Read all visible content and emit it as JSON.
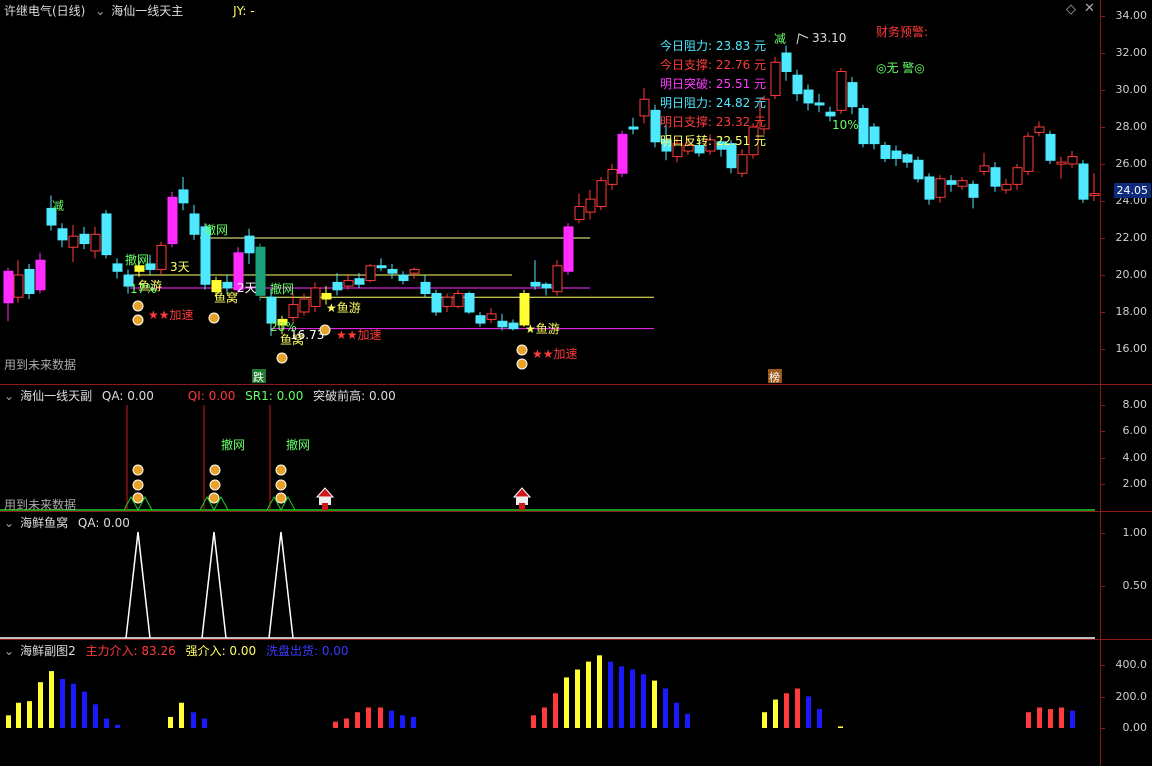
{
  "main": {
    "title": "许继电气(日线)",
    "indicator": "海仙一线天主",
    "jy": "JY: -",
    "future_note": "用到未来数据",
    "levels": [
      {
        "label": "今日阻力:",
        "value": "23.83 元",
        "color": "#4ee8ff"
      },
      {
        "label": "今日支撑:",
        "value": "22.76 元",
        "color": "#ff3b3b"
      },
      {
        "label": "明日突破:",
        "value": "25.51 元",
        "color": "#ff3bff"
      },
      {
        "label": "明日阻力:",
        "value": "24.82 元",
        "color": "#4ee8ff"
      },
      {
        "label": "明日支撑:",
        "value": "23.32 元",
        "color": "#ff3b3b"
      },
      {
        "label": "明日反转:",
        "value": "22.51 元",
        "color": "#ffff66"
      }
    ],
    "finance_warning": "财务预警:",
    "no_warning": "◎无 警◎",
    "high_label": "33.10",
    "jian_top": "减",
    "jian_left": "减",
    "pct_label": "10%",
    "current_price": "24.05",
    "y_ticks": [
      "34.00",
      "32.00",
      "30.00",
      "28.00",
      "26.00",
      "24.00",
      "22.00",
      "20.00",
      "18.00",
      "16.00"
    ],
    "annotations": [
      {
        "t": "撤网",
        "c": "#66ff66"
      },
      {
        "t": "撤网",
        "c": "#66ff66"
      },
      {
        "t": "撤网",
        "c": "#66ff66"
      },
      {
        "t": "鱼游",
        "c": "#ffff66"
      },
      {
        "t": "鱼窝",
        "c": "#ffff66"
      },
      {
        "t": "3天",
        "c": "#ffff66"
      },
      {
        "t": "2天",
        "c": "#ffffff"
      },
      {
        "t": "★鱼游",
        "c": "#ffff66"
      },
      {
        "t": "★鱼游",
        "c": "#ffff66"
      },
      {
        "t": "鱼窝",
        "c": "#ffff66"
      },
      {
        "t": "★★加速",
        "c": "#ff3b3b"
      },
      {
        "t": "★★加速",
        "c": "#ff3b3b"
      },
      {
        "t": "★★加速",
        "c": "#ff3b3b"
      },
      {
        "t": "16.73",
        "c": "#ffffff"
      },
      {
        "t": "20%",
        "c": "#66ff66"
      },
      {
        "t": "17%",
        "c": "#66ff66"
      },
      {
        "t": "10%",
        "c": "#66ff66"
      }
    ],
    "bottom_tags": [
      {
        "t": "跌",
        "bg": "#1e7a2e"
      },
      {
        "t": "榜",
        "bg": "#9a5a1a"
      }
    ]
  },
  "sub1": {
    "title": "海仙一线天副",
    "qa": "QA: 0.00",
    "qi": "QI: 0.00",
    "sr1": "SR1: 0.00",
    "breakout": "突破前高: 0.00",
    "labels": [
      "撤网",
      "撤网"
    ],
    "future_note": "用到未来数据",
    "y_ticks": [
      "8.00",
      "6.00",
      "4.00",
      "2.00"
    ]
  },
  "sub2": {
    "title": "海鲜鱼窝",
    "qa": "QA: 0.00",
    "y_ticks": [
      "1.00",
      "0.50"
    ]
  },
  "sub3": {
    "title": "海鲜副图2",
    "main_in": "主力介入: 83.26",
    "strong_in": "强介入: 0.00",
    "exit": "洗盘出货: 0.00",
    "y_ticks": [
      "400.0",
      "200.0",
      "0.00"
    ]
  },
  "colors": {
    "up": "#ff3b3b",
    "down": "#4ee8ff",
    "magenta": "#ff2bff",
    "yellow": "#ffff33",
    "blue": "#1a1aff",
    "border": "#8b1a1a"
  }
}
